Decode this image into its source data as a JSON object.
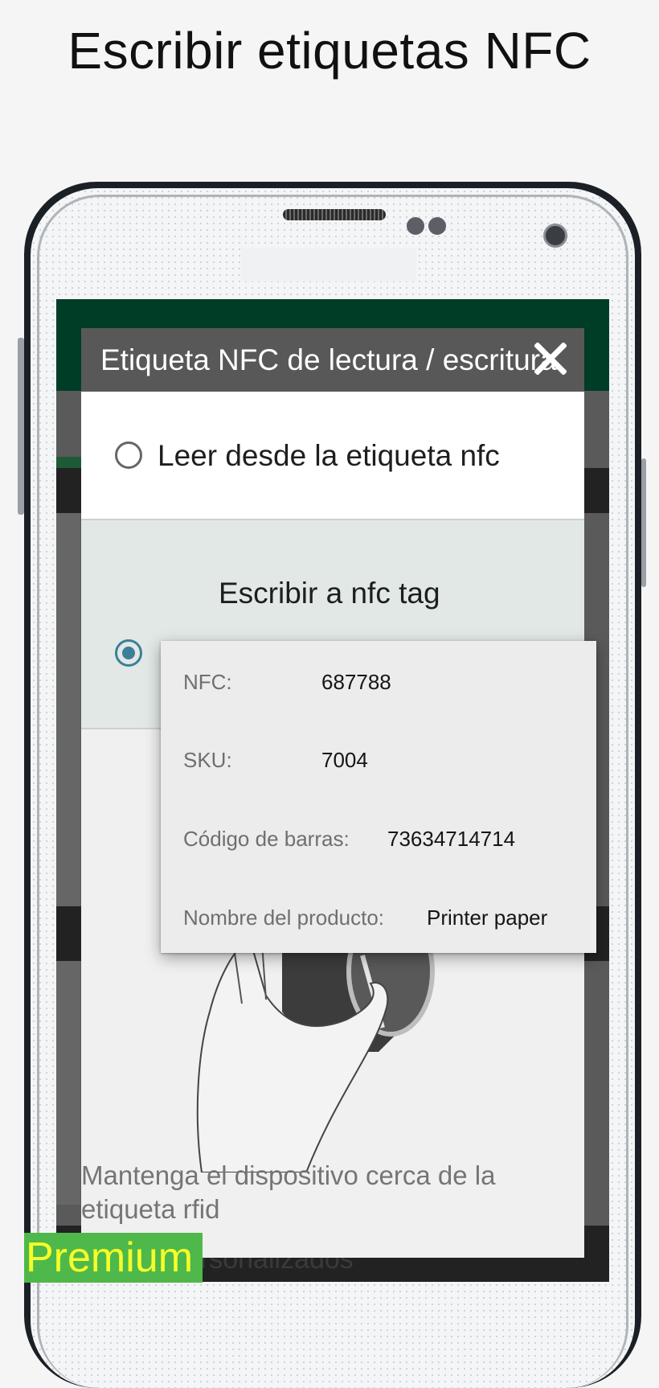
{
  "headline": "Escribir etiquetas NFC",
  "dialog": {
    "title": "Etiqueta NFC de lectura / escritura",
    "option_read": "Leer desde la etiqueta nfc",
    "option_write": "Escribir a nfc tag",
    "selected": "write",
    "hint": "Mantenga el dispositivo cerca de la etiqueta rfid"
  },
  "tag_info": {
    "nfc_label": "NFC:",
    "nfc_value": "687788",
    "sku_label": "SKU:",
    "sku_value": "7004",
    "barcode_label": "Código de barras:",
    "barcode_value": "73634714714",
    "product_label": "Nombre del producto:",
    "product_value": "Printer paper"
  },
  "background_text": "ersonalizados",
  "badge": "Premium",
  "colors": {
    "app_bar": "#003d26",
    "dialog_title_bg": "#585858",
    "radio_accent": "#3d7f96",
    "badge_bg": "#4fb84a",
    "badge_text": "#f7ff28"
  }
}
